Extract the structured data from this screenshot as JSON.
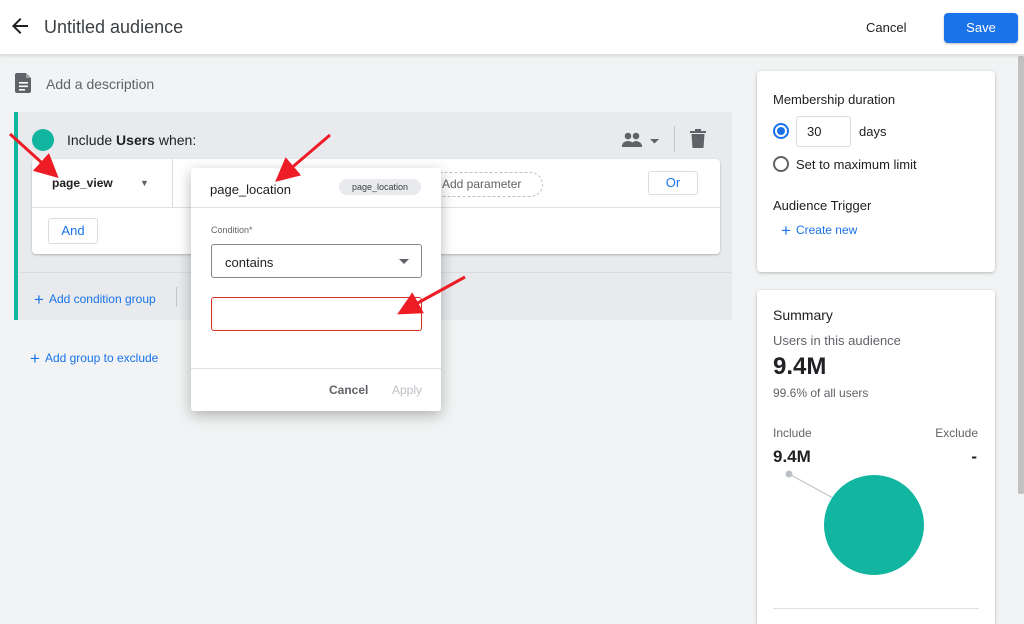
{
  "header": {
    "title": "Untitled audience",
    "cancel_label": "Cancel",
    "save_label": "Save",
    "back_icon": "arrow-back-icon"
  },
  "description": {
    "placeholder": "Add a description",
    "icon": "document-icon"
  },
  "include_group": {
    "prefix": "Include ",
    "subject": "Users",
    "suffix": " when:",
    "accent_color": "#12b5a0",
    "event_name": "page_view",
    "add_parameter_label": "Add parameter",
    "or_label": "Or",
    "and_label": "And",
    "add_condition_group_label": "Add condition group",
    "scope_icon": "people-icon",
    "delete_icon": "trash-icon"
  },
  "add_group_to_exclude_label": "Add group to exclude",
  "popup": {
    "title": "page_location",
    "chip": "page_location",
    "condition_label": "Condition*",
    "condition_value": "contains",
    "value_input": "",
    "cancel_label": "Cancel",
    "apply_label": "Apply"
  },
  "membership": {
    "title": "Membership duration",
    "days_value": "30",
    "days_label": "days",
    "max_limit_label": "Set to maximum limit",
    "selected_option": "days",
    "trigger_title": "Audience Trigger",
    "create_new_label": "Create new"
  },
  "summary": {
    "title": "Summary",
    "users_label": "Users in this audience",
    "users_value": "9.4M",
    "percent_label": "99.6% of all users",
    "include_label": "Include",
    "exclude_label": "Exclude",
    "include_value": "9.4M",
    "exclude_value": "-",
    "pie_color": "#12b5a0"
  },
  "colors": {
    "primary": "#1a73e8",
    "error": "#d93025",
    "annotation_arrow": "#ee1c25"
  }
}
